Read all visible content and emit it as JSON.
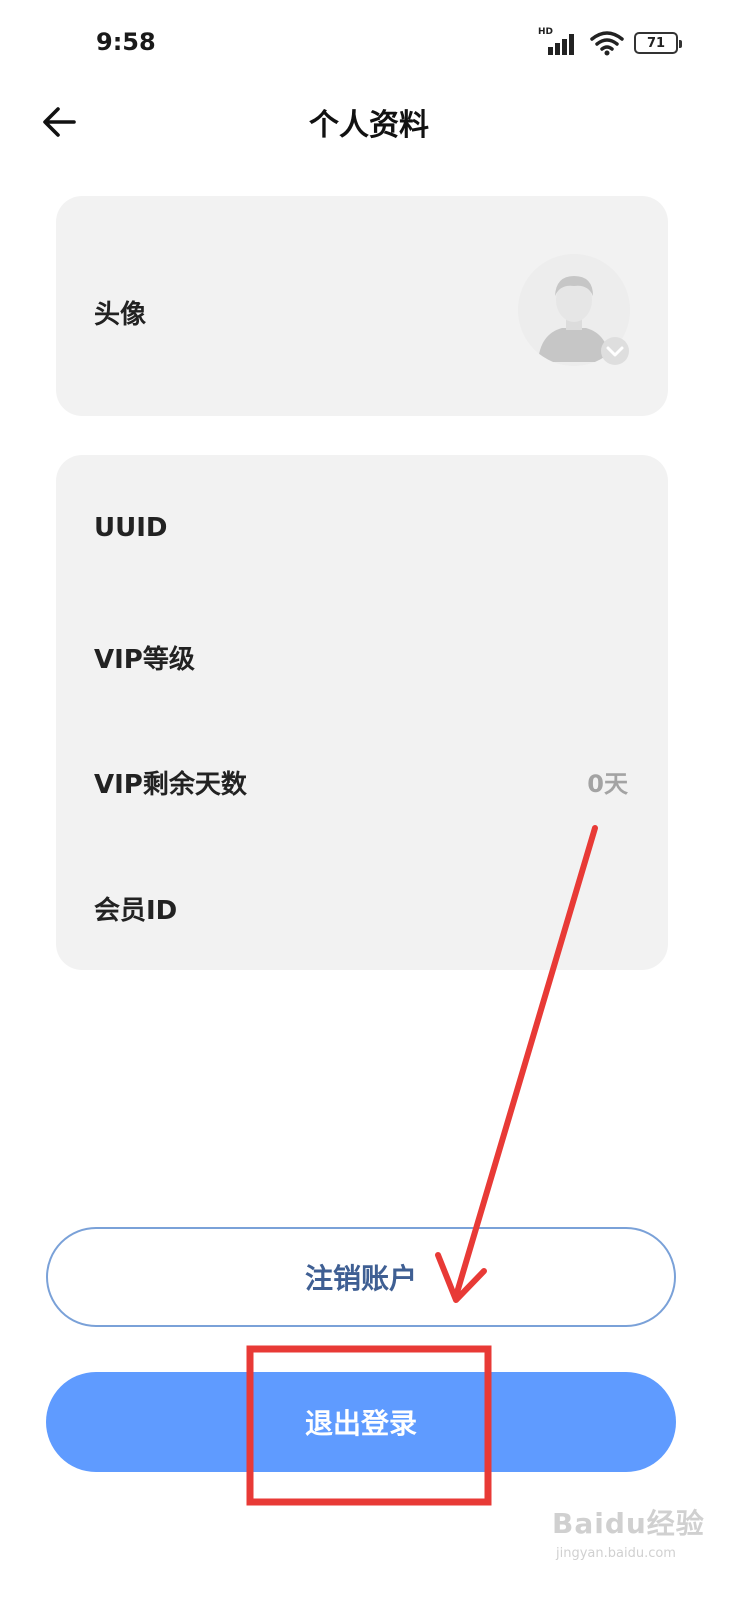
{
  "status_bar": {
    "time": "9:58",
    "network": "HD",
    "battery": "71"
  },
  "header": {
    "title": "个人资料"
  },
  "avatar_section": {
    "label": "头像"
  },
  "info": {
    "rows": [
      {
        "label": "UUID",
        "value": ""
      },
      {
        "label": "VIP等级",
        "value": ""
      },
      {
        "label": "VIP剩余天数",
        "value": "0天"
      },
      {
        "label": "会员ID",
        "value": ""
      }
    ]
  },
  "actions": {
    "cancel_account": "注销账户",
    "logout": "退出登录"
  },
  "annotation": {
    "color": "#e83a36"
  },
  "watermark": {
    "brand": "Baidu经验",
    "url": "jingyan.baidu.com"
  }
}
